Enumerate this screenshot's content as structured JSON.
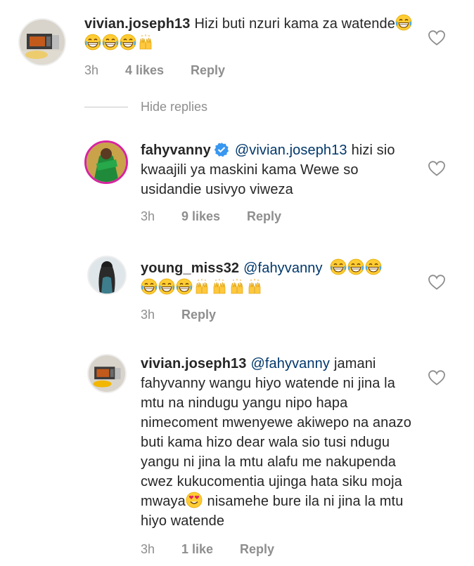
{
  "comments": [
    {
      "username": "vivian.joseph13",
      "mention": "",
      "text": "Hizi buti nzuri kama za watende",
      "emoji": [
        "grin",
        "grin",
        "grin",
        "grin",
        "raised-hands"
      ],
      "time": "3h",
      "likes": "4 likes",
      "reply": "Reply",
      "avatar": "toaster-oven-photo"
    },
    {
      "username": "fahyvanny",
      "verified": true,
      "mention": "@vivian.joseph13",
      "text": "hizi sio kwaajili ya maskini kama Wewe so usidandie usivyo viweza",
      "time": "3h",
      "likes": "9 likes",
      "reply": "Reply",
      "avatar": "green-outfit-photo"
    },
    {
      "username": "young_miss32",
      "mention": "@fahyvanny",
      "text": "",
      "emoji": [
        "grin",
        "grin",
        "grin",
        "grin",
        "grin",
        "grin",
        "raised-hands",
        "raised-hands",
        "raised-hands",
        "raised-hands"
      ],
      "time": "3h",
      "likes": "",
      "reply": "Reply",
      "avatar": "silhouette-photo"
    },
    {
      "username": "vivian.joseph13",
      "mention": "@fahyvanny",
      "text": "jamani fahyvanny wangu hiyo watende ni jina la mtu na nindugu yangu nipo hapa nimecoment mwenyewe akiwepo na anazo buti kama hizo dear wala sio tusi ndugu yangu ni jina la mtu alafu me nakupenda cwez kukucomentia ujinga hata siku moja mwaya",
      "text_after_emoji": "nisamehe bure ila ni jina la mtu hiyo watende",
      "emoji": [
        "heart-eyes"
      ],
      "time": "3h",
      "likes": "1 like",
      "reply": "Reply",
      "avatar": "toaster-oven-photo"
    }
  ],
  "hide_replies": "Hide replies",
  "colors": {
    "text": "#262626",
    "meta": "#8e8e8e",
    "mention": "#00376b",
    "verified": "#3897f0"
  }
}
